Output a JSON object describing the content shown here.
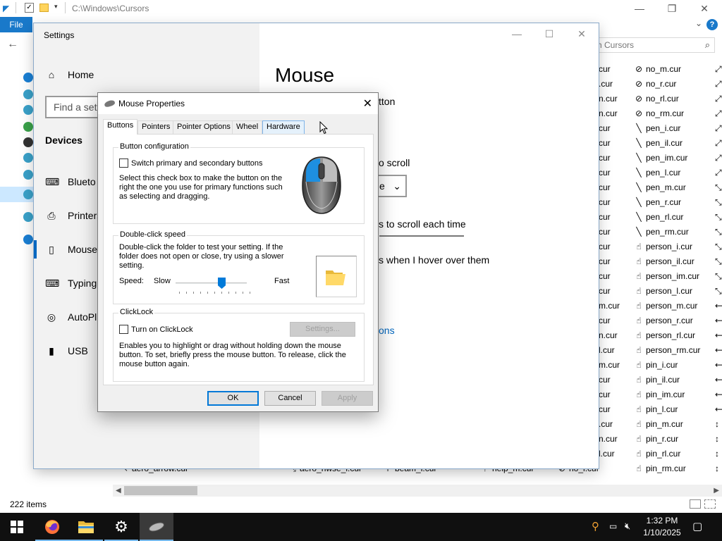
{
  "explorer": {
    "address_path": "C:\\Windows\\Cursors",
    "file_tab": "File",
    "search_placeholder": "h Cursors",
    "status_items": "222 items",
    "window_controls": [
      "—",
      "❐",
      "✕"
    ],
    "col_partial": [
      "cur",
      ".cur",
      "n.cur",
      "n.cur",
      "cur",
      "cur",
      "cur",
      "cur",
      "cur",
      "cur",
      "cur",
      "cur",
      "cur",
      "cur",
      "cur",
      "cur",
      "m.cur",
      "cur",
      "n.cur",
      "l.cur",
      "m.cur",
      "cur",
      "cur",
      "cur",
      ".cur",
      "n.cur",
      "l.cur"
    ],
    "files": [
      "no_m.cur",
      "no_r.cur",
      "no_rl.cur",
      "no_rm.cur",
      "pen_i.cur",
      "pen_il.cur",
      "pen_im.cur",
      "pen_l.cur",
      "pen_m.cur",
      "pen_r.cur",
      "pen_rl.cur",
      "pen_rm.cur",
      "person_i.cur",
      "person_il.cur",
      "person_im.cur",
      "person_l.cur",
      "person_m.cur",
      "person_r.cur",
      "person_rl.cur",
      "person_rm.cur",
      "pin_i.cur",
      "pin_il.cur",
      "pin_im.cur",
      "pin_l.cur",
      "pin_m.cur",
      "pin_r.cur",
      "pin_rl.cur",
      "pin_rm.cur"
    ],
    "bottom_row": [
      "aero_arrow.cur",
      "aero_nwse_l.cur",
      "beam_l.cur",
      "help_m.cur",
      "no_i.cur"
    ],
    "right_col_arrows": [
      "⤢",
      "⤢",
      "⤢",
      "⤢",
      "⤢",
      "⤢",
      "⤢",
      "⤢",
      "⤡",
      "⤡",
      "⤡",
      "⤡",
      "⤡",
      "⤡",
      "⤡",
      "⤡",
      "⟷",
      "⟷",
      "⟷",
      "⟷",
      "⟷",
      "⟷",
      "⟷",
      "⟷",
      "↕",
      "↕",
      "↕",
      "↕"
    ]
  },
  "settings": {
    "window_title": "Settings",
    "home": "Home",
    "find_placeholder": "Find a sett",
    "section": "Devices",
    "nav": [
      "Blueto",
      "Printers",
      "Mouse",
      "Typing",
      "AutoPl",
      "USB"
    ],
    "page_title": "Mouse",
    "primary_button_partial": "tton",
    "scroll_label_partial": "o scroll",
    "dropdown_partial": "e",
    "lines_partial": "s to scroll each time",
    "hover_partial": "s when I hover over them",
    "link_partial": "ons"
  },
  "dialog": {
    "title": "Mouse Properties",
    "tabs": [
      "Buttons",
      "Pointers",
      "Pointer Options",
      "Wheel",
      "Hardware"
    ],
    "button_config": {
      "legend": "Button configuration",
      "checkbox_label": "Switch primary and secondary buttons",
      "description": "Select this check box to make the button on the right the one you use for primary functions such as selecting and dragging."
    },
    "double_click": {
      "legend": "Double-click speed",
      "description": "Double-click the folder to test your setting. If the folder does not open or close, try using a slower setting.",
      "speed_label": "Speed:",
      "slow": "Slow",
      "fast": "Fast",
      "speed_value": 0.6
    },
    "clicklock": {
      "legend": "ClickLock",
      "checkbox_label": "Turn on ClickLock",
      "settings_button": "Settings...",
      "description": "Enables you to highlight or drag without holding down the mouse button. To set, briefly press the mouse button. To release, click the mouse button again."
    },
    "buttons": {
      "ok": "OK",
      "cancel": "Cancel",
      "apply": "Apply"
    }
  },
  "taskbar": {
    "time": "1:32 PM",
    "date": "1/10/2025"
  },
  "colors": {
    "accent": "#0078d7",
    "file_tab": "#1979ca",
    "taskbar": "#101010"
  }
}
